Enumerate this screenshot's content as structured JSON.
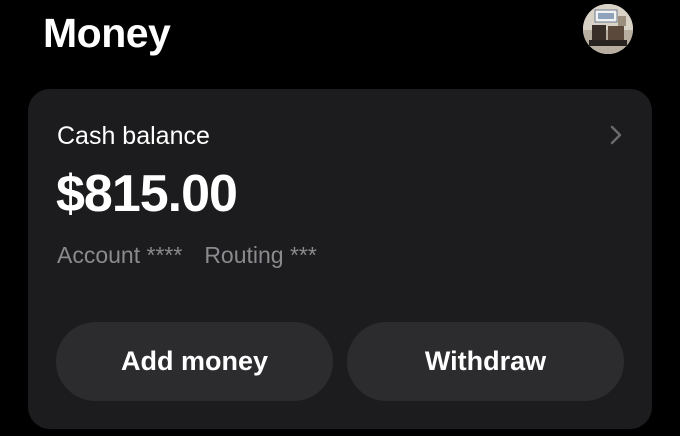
{
  "header": {
    "title": "Money",
    "avatar_icon": "profile-avatar"
  },
  "balance_card": {
    "title": "Cash balance",
    "chevron_icon": "chevron-right-icon",
    "amount": "$815.00",
    "account_label": "Account ****",
    "routing_label": "Routing ***"
  },
  "actions": {
    "add_money_label": "Add money",
    "withdraw_label": "Withdraw"
  },
  "colors": {
    "background": "#000000",
    "card": "#1c1c1e",
    "button": "#2c2c2e",
    "secondary_text": "#8a8a8e"
  }
}
